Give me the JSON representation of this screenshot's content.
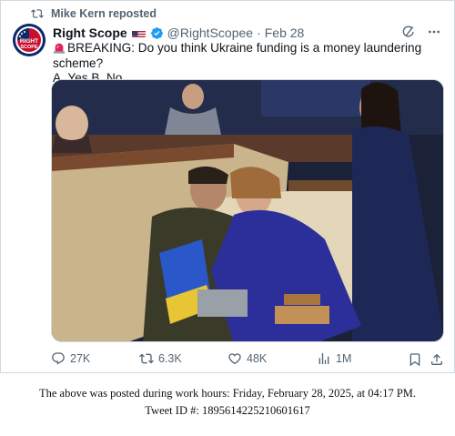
{
  "repost": {
    "label": "Mike Kern reposted",
    "icon": "repost-icon"
  },
  "author": {
    "name": "Right Scope",
    "flag": "us-flag-icon",
    "badge": "verified-badge-icon",
    "handle": "@RightScopee",
    "separator": "·",
    "date": "Feb 28",
    "avatar_text_top": "RIGHT",
    "avatar_text_bottom": "SCOPE"
  },
  "tweet": {
    "emoji": "siren-icon",
    "line1": "BREAKING: Do you think Ukraine funding is a money laundering scheme?",
    "line2": "A. Yes B. No"
  },
  "stats": {
    "replies": "27K",
    "reposts": "6.3K",
    "likes": "48K",
    "views": "1M"
  },
  "footer": {
    "line1": "The above was posted during work hours: Friday, February 28, 2025, at 04:17 PM.",
    "line2": "Tweet ID #: 1895614225210601617"
  },
  "colors": {
    "text": "#0f1419",
    "muted": "#536471",
    "border": "#cfd9de",
    "verified": "#1d9bf0"
  }
}
